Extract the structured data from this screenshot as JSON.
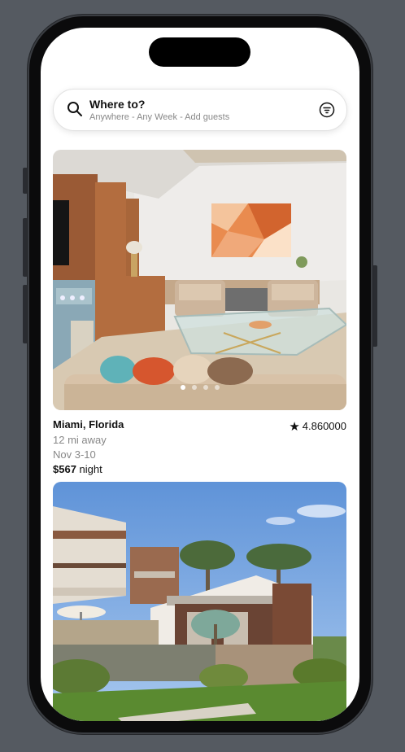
{
  "search": {
    "title": "Where to?",
    "subtitle": "Anywhere - Any Week - Add guests"
  },
  "icons": {
    "search": "search-icon",
    "filter": "filter-icon",
    "rating": "star-icon"
  },
  "listings": [
    {
      "location": "Miami, Florida",
      "rating": "4.860000",
      "distance": "12 mi away",
      "dates": "Nov 3-10",
      "price": "$567",
      "price_unit": "night",
      "carousel_dots": 4,
      "active_dot": 1
    }
  ],
  "colors": {
    "accent": "#111111",
    "muted_text": "#888888",
    "background": "#ffffff"
  }
}
